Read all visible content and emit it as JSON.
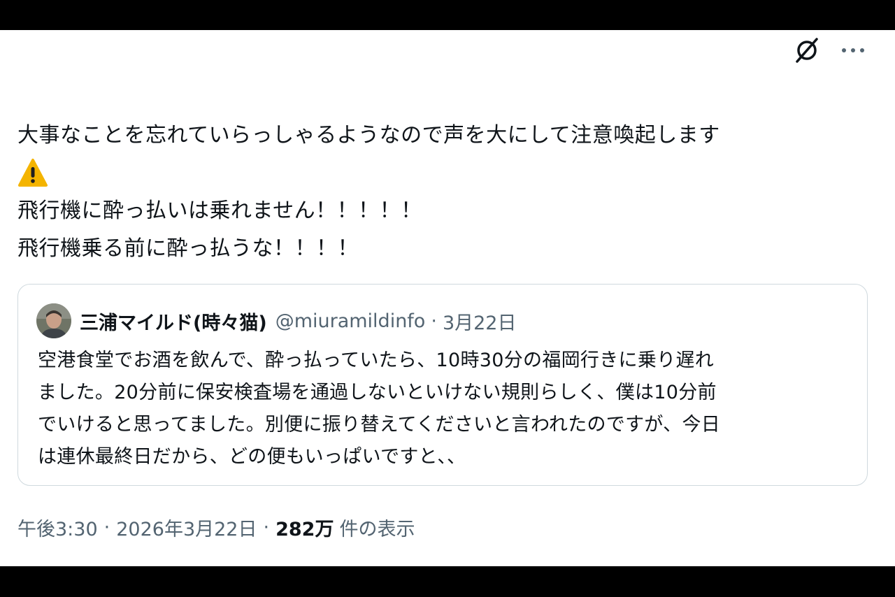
{
  "toolbar": {
    "grok_icon": "grok-icon",
    "more_icon": "more-horizontal-icon"
  },
  "tweet": {
    "lines": [
      "大事なことを忘れていらっしゃるようなので声を大にして注意喚起します",
      "飛行機に酔っ払いは乗れません！！！！！",
      "飛行機乗る前に酔っ払うな！！！！"
    ],
    "warning_icon": "warning-icon"
  },
  "quote": {
    "name": "三浦マイルド(時々猫)",
    "handle": "@miuramildinfo",
    "separator": "·",
    "date": "3月22日",
    "lines": [
      "空港食堂でお酒を飲んで、酔っ払っていたら、10時30分の福岡行きに乗り遅れ",
      "ました。20分前に保安検査場を通過しないといけない規則らしく、僕は10分前",
      "でいけると思ってました。別便に振り替えてくださいと言われたのですが、今日",
      "は連休最終日だから、どの便もいっぱいですと､､"
    ]
  },
  "meta": {
    "time": "午後3:30",
    "separator": "·",
    "date": "2026年3月22日",
    "views_count": "282万",
    "views_label": "件の表示"
  },
  "colors": {
    "text": "#0f1419",
    "secondary": "#536471",
    "border": "#cfd9de",
    "warning": "#f4b400"
  }
}
